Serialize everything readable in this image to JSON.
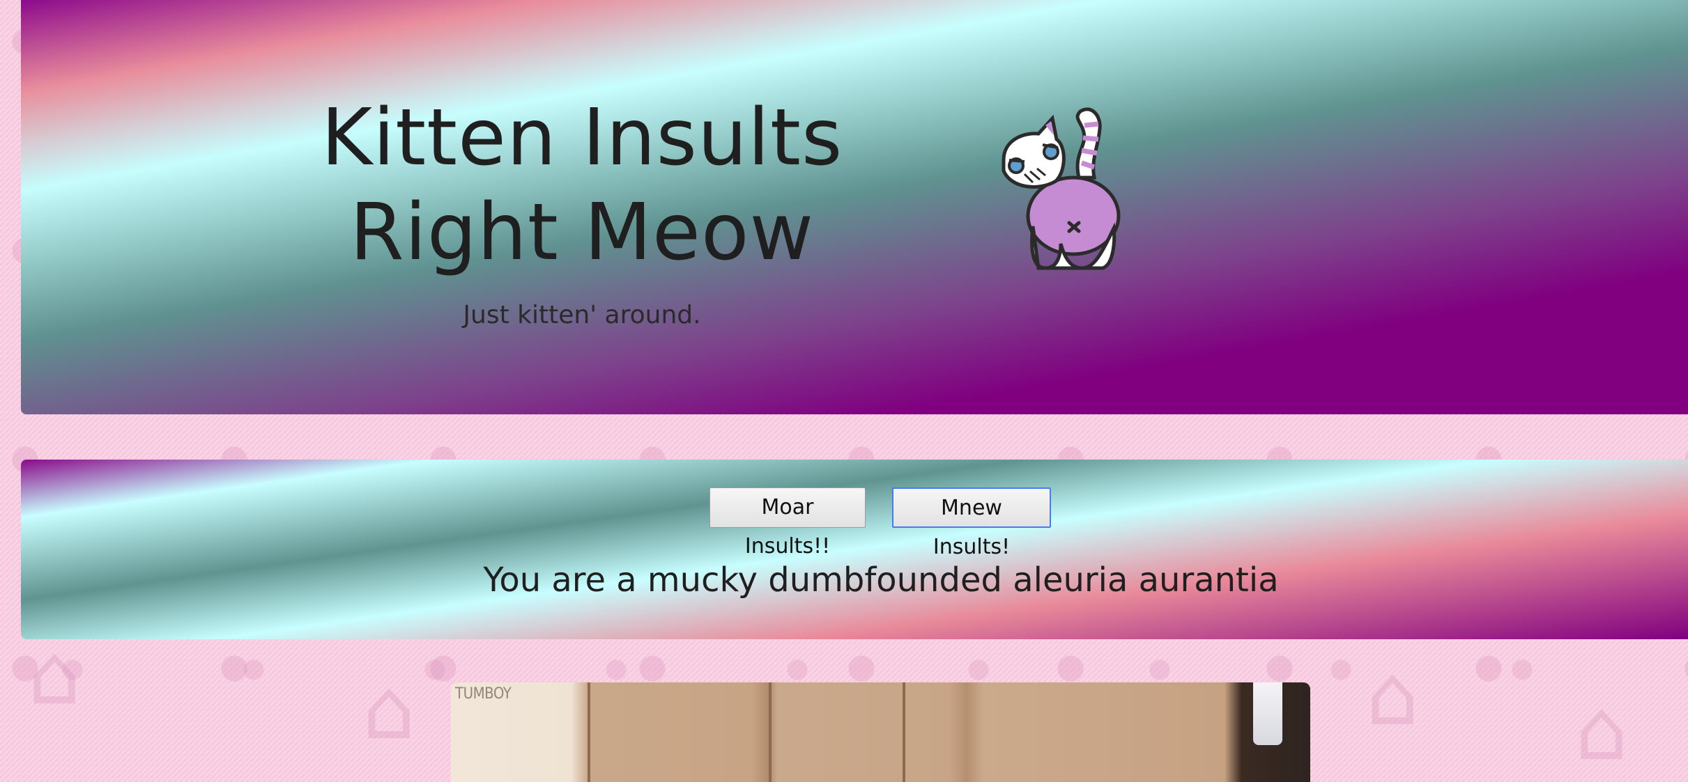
{
  "header": {
    "title": "Kitten Insults Right Meow",
    "subtitle": "Just kitten' around."
  },
  "logo": {
    "icon": "cat-butt-icon",
    "colors": {
      "body": "#c58bd3",
      "outline": "#2b2b2b",
      "eyes": "#5f9fd0"
    }
  },
  "insults": {
    "more_button": "Moar Insults!!",
    "new_button": "Mnew Insults!",
    "current": "You are a mucky dumbfounded aleuria aurantia"
  },
  "gif": {
    "watermark": "TUMBOY"
  },
  "colors": {
    "purple": "#80007f",
    "pink": "#e98a9a",
    "cyan": "#c8feff",
    "teal": "#5f9490",
    "background": "#f7c9de",
    "button_focus": "#4b7bea"
  }
}
